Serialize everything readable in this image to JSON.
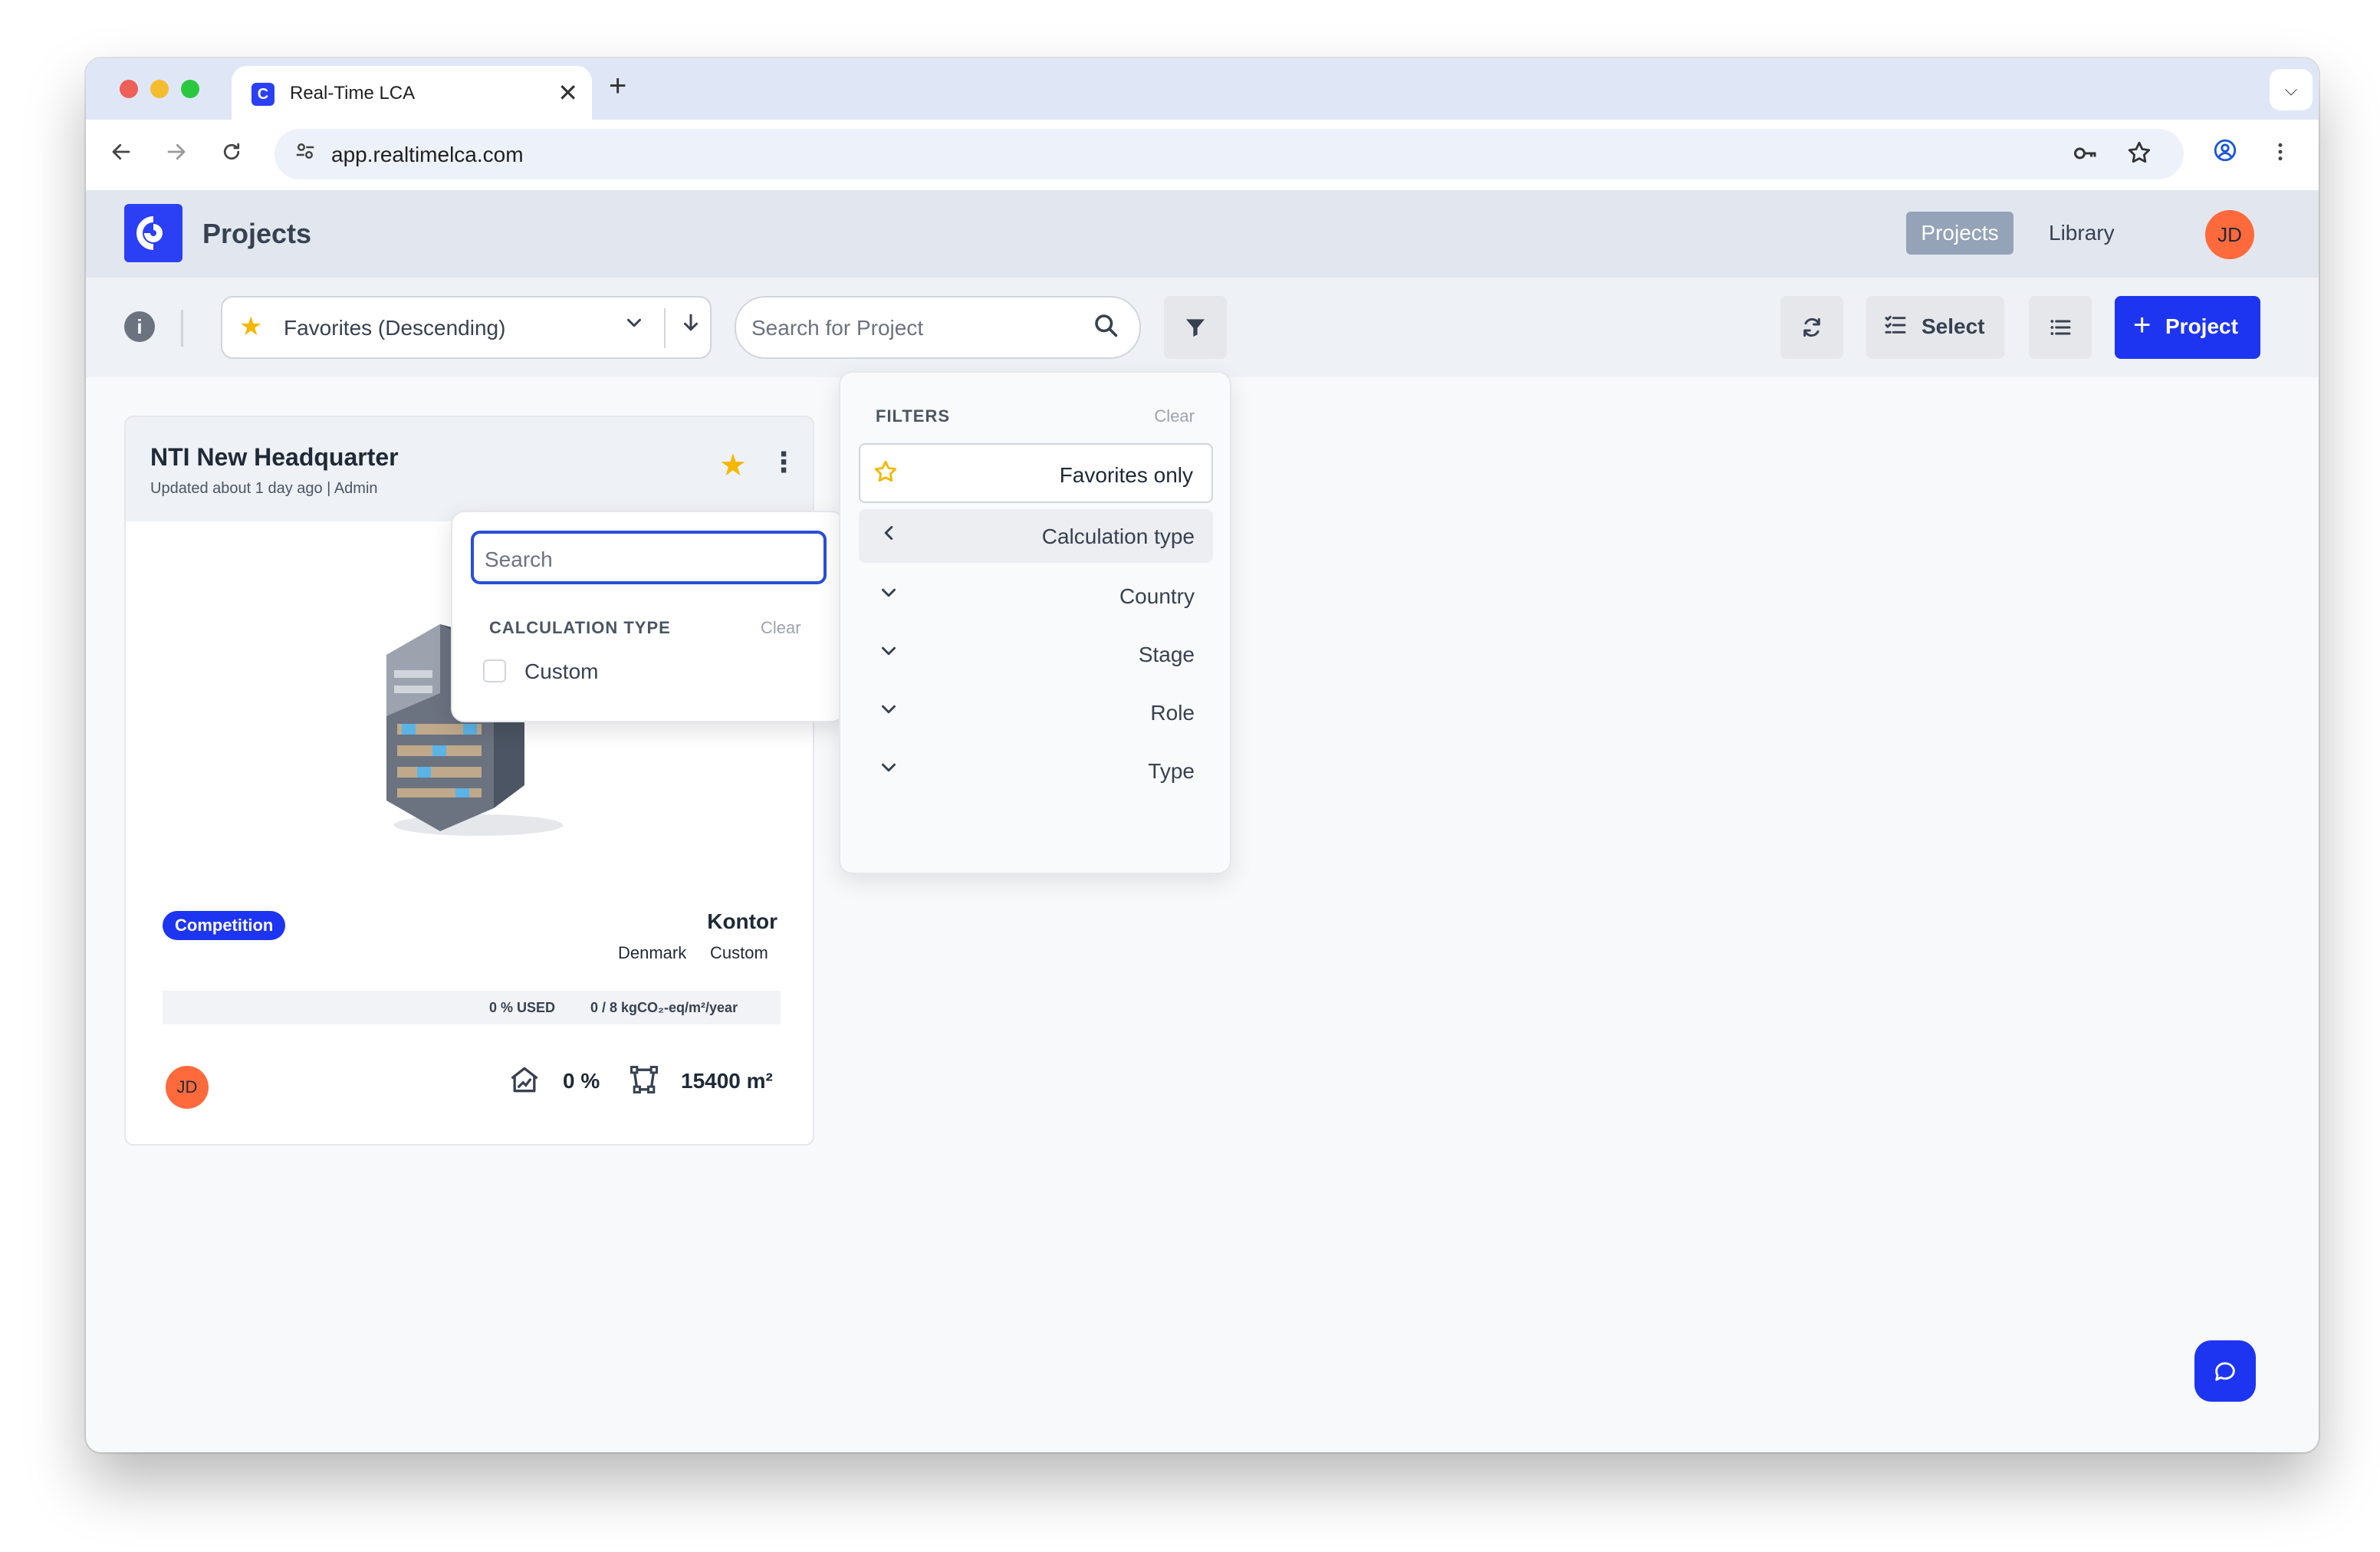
{
  "browser": {
    "tab_title": "Real-Time LCA",
    "tab_close": "✕",
    "new_tab": "+",
    "url": "app.realtimelca.com"
  },
  "header": {
    "title": "Projects",
    "nav": {
      "projects": "Projects",
      "library": "Library"
    },
    "user_initials": "JD"
  },
  "toolbar": {
    "sort_label": "Favorites (Descending)",
    "search_placeholder": "Search for Project",
    "select_label": "Select",
    "add_label": "Project"
  },
  "project_card": {
    "title": "NTI New Headquarter",
    "subtitle": "Updated about 1 day ago | Admin",
    "badge": "Competition",
    "building_type": "Kontor",
    "country": "Denmark",
    "calculation": "Custom",
    "usage_label": "0 % USED",
    "usage_value": "0 / 8 kgCO₂-eq/m²/year",
    "owner_initials": "JD",
    "share_percent": "0 %",
    "area": "15400 m²",
    "is_favorite": true
  },
  "calculation_popover": {
    "search_placeholder": "Search",
    "heading": "CALCULATION TYPE",
    "clear": "Clear",
    "options": [
      {
        "label": "Custom",
        "checked": false
      }
    ]
  },
  "filters": {
    "heading": "FILTERS",
    "clear": "Clear",
    "favorites_only": "Favorites only",
    "items": [
      {
        "label": "Calculation type",
        "expanded": true
      },
      {
        "label": "Country",
        "expanded": false
      },
      {
        "label": "Stage",
        "expanded": false
      },
      {
        "label": "Role",
        "expanded": false
      },
      {
        "label": "Type",
        "expanded": false
      }
    ]
  },
  "icons": {
    "back": "arrow-left-icon",
    "forward": "arrow-right-icon",
    "reload": "reload-icon",
    "site_settings": "tune-icon",
    "password": "key-icon",
    "bookmark": "star-outline-icon",
    "profile": "account-circle-icon",
    "browser_menu": "kebab-icon",
    "chat": "chat-bubble-icon"
  },
  "colors": {
    "brand": "#1d35f0",
    "favorite": "#f5b700",
    "avatar": "#ff6a3d",
    "focus": "#2a4fd6"
  }
}
